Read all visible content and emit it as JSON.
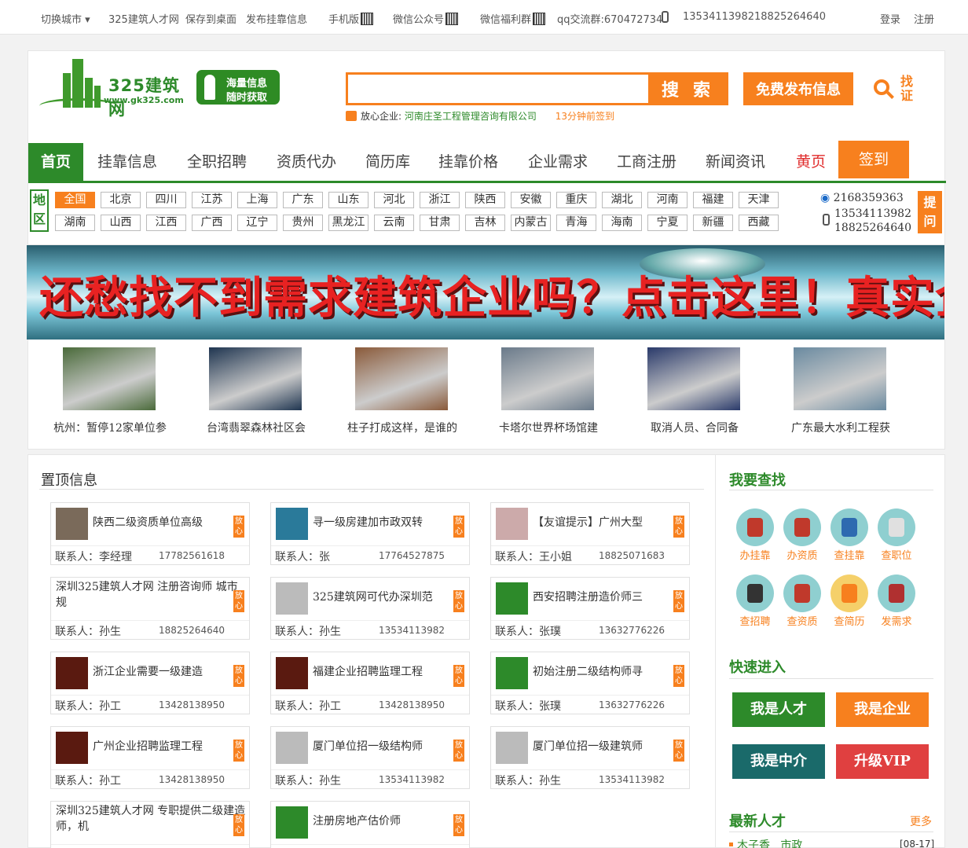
{
  "topbar": {
    "switch_city": "切换城市",
    "site_name": "325建筑人才网",
    "save_desktop": "保存到桌面",
    "publish_info": "发布挂靠信息",
    "mobile": "手机版",
    "wechat_public": "微信公众号",
    "wechat_group": "微信福利群",
    "qq_group": "qq交流群:670472734",
    "phone1": "13534113982",
    "phone2": "18825264640",
    "login": "登录",
    "register": "注册"
  },
  "header": {
    "logo_name": "325建筑网",
    "logo_url": "www.gk325.com",
    "slogan1": "海量信息",
    "slogan2": "随时获取",
    "search_button": "搜 索",
    "publish_button": "免费发布信息",
    "find_cert": "找证",
    "notice_label": "放心企业:",
    "notice_company": "河南庄圣工程管理咨询有限公司",
    "notice_time": "13分钟前签到"
  },
  "nav": {
    "items": [
      "首页",
      "挂靠信息",
      "全职招聘",
      "资质代办",
      "简历库",
      "挂靠价格",
      "企业需求",
      "工商注册",
      "新闻资讯",
      "黄页"
    ],
    "sign": "签到"
  },
  "region": {
    "label": "地区",
    "cities_row1": [
      "全国",
      "北京",
      "四川",
      "江苏",
      "上海",
      "广东",
      "山东",
      "河北",
      "浙江",
      "陕西",
      "安徽",
      "重庆",
      "湖北",
      "河南",
      "福建",
      "天津"
    ],
    "cities_row2": [
      "湖南",
      "山西",
      "江西",
      "广西",
      "辽宁",
      "贵州",
      "黑龙江",
      "云南",
      "甘肃",
      "吉林",
      "内蒙古",
      "青海",
      "海南",
      "宁夏",
      "新疆",
      "西藏"
    ],
    "qq": "2168359363",
    "phone1": "13534113982",
    "phone2": "18825264640",
    "ask": "提问"
  },
  "banner": {
    "text": "还愁找不到需求建筑企业吗？点击这里！真实企业需求！！！"
  },
  "news": [
    {
      "caption": "杭州：暂停12家单位参",
      "color": "#4a6a3a"
    },
    {
      "caption": "台湾翡翠森林社区会",
      "color": "#1f3550"
    },
    {
      "caption": "柱子打成这样，是谁的",
      "color": "#8a5a3a"
    },
    {
      "caption": "卡塔尔世界杯场馆建",
      "color": "#6a7a8a"
    },
    {
      "caption": "取消人员、合同备",
      "color": "#2a3a6a"
    },
    {
      "caption": "广东最大水利工程获",
      "color": "#6a8aa0"
    }
  ],
  "main": {
    "title": "置顶信息",
    "badge": "放心",
    "contact_prefix": "联系人：",
    "cards": [
      {
        "title": "陕西二级资质单位高级",
        "contact": "李经理",
        "phone": "17782561618",
        "img": "#7a6a5a"
      },
      {
        "title": "寻一级房建加市政双转",
        "contact": "张",
        "phone": "17764527875",
        "img": "#2a7a9a"
      },
      {
        "title": "【友谊提示】广州大型",
        "contact": "王小姐",
        "phone": "18825071683",
        "img": "#caa"
      },
      {
        "title": "深圳325建筑人才网 注册咨询师 城市规",
        "contact": "孙生",
        "phone": "18825264640",
        "img": ""
      },
      {
        "title": "325建筑网可代办深圳范",
        "contact": "孙生",
        "phone": "13534113982",
        "img": "#bbb"
      },
      {
        "title": "西安招聘注册造价师三",
        "contact": "张璞",
        "phone": "13632776226",
        "img": "#2d8a2a"
      },
      {
        "title": "浙江企业需要一级建造",
        "contact": "孙工",
        "phone": "13428138950",
        "img": "#5a1a10"
      },
      {
        "title": "福建企业招聘监理工程",
        "contact": "孙工",
        "phone": "13428138950",
        "img": "#5a1a10"
      },
      {
        "title": "初始注册二级结构师寻",
        "contact": "张璞",
        "phone": "13632776226",
        "img": "#2d8a2a"
      },
      {
        "title": "广州企业招聘监理工程",
        "contact": "孙工",
        "phone": "13428138950",
        "img": "#5a1a10"
      },
      {
        "title": "厦门单位招一级结构师",
        "contact": "孙生",
        "phone": "13534113982",
        "img": "#bbb"
      },
      {
        "title": "厦门单位招一级建筑师",
        "contact": "孙生",
        "phone": "13534113982",
        "img": "#bbb"
      },
      {
        "title": "深圳325建筑人才网 专职提供二级建造师，机",
        "contact": "",
        "phone": "",
        "img": ""
      },
      {
        "title": "注册房地产估价师",
        "contact": "",
        "phone": "",
        "img": "#2d8a2a"
      }
    ]
  },
  "side": {
    "find_title": "我要查找",
    "find_items": [
      "办挂靠",
      "办资质",
      "查挂靠",
      "查职位",
      "查招聘",
      "查资质",
      "查简历",
      "发需求"
    ],
    "quick_title": "快速进入",
    "quick": [
      "我是人才",
      "我是企业",
      "我是中介",
      "升级VIP"
    ],
    "latest_title": "最新人才",
    "more": "更多",
    "latest_name": "木子香",
    "latest_major": "市政",
    "latest_date": "[08-17]"
  }
}
